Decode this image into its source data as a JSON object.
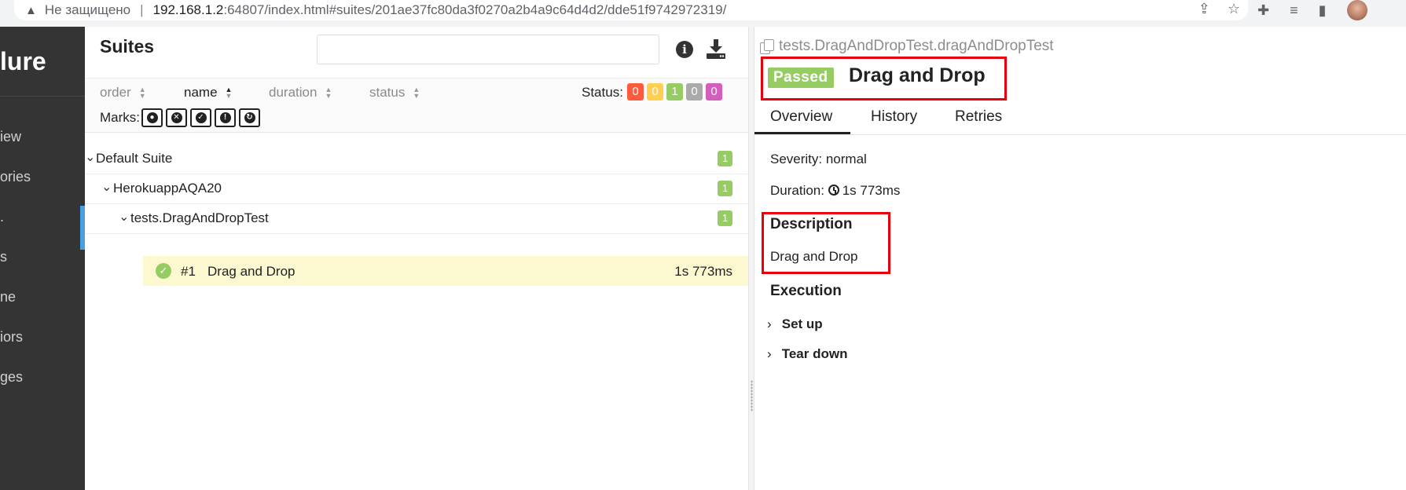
{
  "browser": {
    "insecure_label": "Не защищено",
    "url_host": "192.168.1.2",
    "url_rest": ":64807/index.html#suites/201ae37fc80da3f0270a2b4a9c64d4d2/dde51f9742972319/"
  },
  "sidebar": {
    "logo": "lure",
    "items": [
      {
        "label": "iew"
      },
      {
        "label": "ories"
      },
      {
        "label": "."
      },
      {
        "label": "s"
      },
      {
        "label": "ne"
      },
      {
        "label": "iors"
      },
      {
        "label": "ges"
      }
    ]
  },
  "suites": {
    "title": "Suites",
    "search_placeholder": "",
    "sort": {
      "order": "order",
      "name": "name",
      "duration": "duration",
      "status": "status"
    },
    "status_label": "Status:",
    "status_counts": [
      {
        "value": "0",
        "color": "#fd5a3e"
      },
      {
        "value": "0",
        "color": "#ffd050"
      },
      {
        "value": "1",
        "color": "#97cc64"
      },
      {
        "value": "0",
        "color": "#aaaaaa"
      },
      {
        "value": "0",
        "color": "#d35ebe"
      }
    ],
    "marks_label": "Marks:",
    "marks": [
      "bomb-icon",
      "times-circle-icon",
      "check-circle-icon",
      "exclamation-circle-icon",
      "refresh-icon"
    ],
    "tree": [
      {
        "label": "Default Suite",
        "count": "1"
      },
      {
        "label": "HerokuappAQA20",
        "count": "1"
      },
      {
        "label": "tests.DragAndDropTest",
        "count": "1"
      }
    ],
    "test": {
      "num": "#1",
      "name": "Drag and Drop",
      "duration": "1s 773ms"
    }
  },
  "detail": {
    "breadcrumb": "tests.DragAndDropTest.dragAndDropTest",
    "status": "Passed",
    "title": "Drag and Drop",
    "tabs": [
      "Overview",
      "History",
      "Retries"
    ],
    "severity": "Severity: normal",
    "duration_prefix": "Duration:",
    "duration": "1s 773ms",
    "description_heading": "Description",
    "description": "Drag and Drop",
    "execution_heading": "Execution",
    "steps": [
      "Set up",
      "Tear down"
    ]
  }
}
